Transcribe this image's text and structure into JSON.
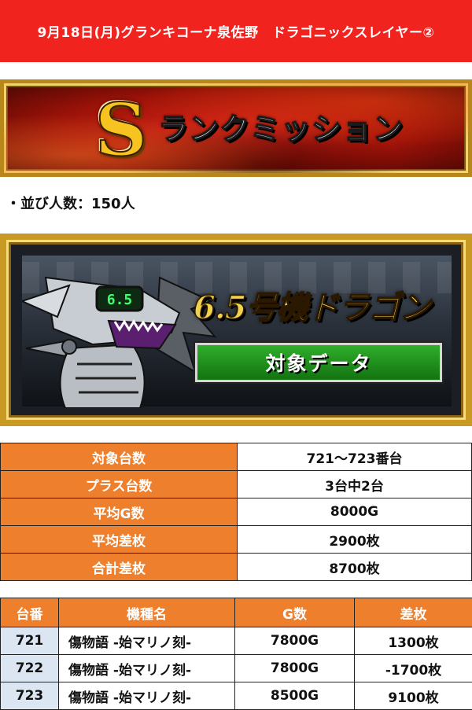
{
  "header": {
    "title": "9月18日(月)グランキコーナ泉佐野　ドラゴニックスレイヤー②"
  },
  "rank_banner": {
    "letter": "S",
    "title": "ランクミッション"
  },
  "queue": {
    "text": "・並び人数：150人"
  },
  "dragon_card": {
    "title": "6.5号機ドラゴン",
    "button": "対象データ",
    "visor_text": "6.5"
  },
  "summary": [
    {
      "label": "対象台数",
      "value": "721～723番台"
    },
    {
      "label": "プラス台数",
      "value": "3台中2台"
    },
    {
      "label": "平均G数",
      "value": "8000G"
    },
    {
      "label": "平均差枚",
      "value": "2900枚"
    },
    {
      "label": "合計差枚",
      "value": "8700枚"
    }
  ],
  "details": {
    "headers": [
      "台番",
      "機種名",
      "G数",
      "差枚"
    ],
    "rows": [
      {
        "num": "721",
        "machine": "傷物語 -始マリノ刻-",
        "games": "7800G",
        "diff": "1300枚"
      },
      {
        "num": "722",
        "machine": "傷物語 -始マリノ刻-",
        "games": "7800G",
        "diff": "-1700枚"
      },
      {
        "num": "723",
        "machine": "傷物語 -始マリノ刻-",
        "games": "8500G",
        "diff": "9100枚"
      }
    ]
  },
  "colors": {
    "header_red": "#f1231f",
    "table_orange": "#ee7f2d",
    "id_cell_blue": "#dce6f2",
    "gold": "#c99a23",
    "button_green": "#2fae2a"
  }
}
